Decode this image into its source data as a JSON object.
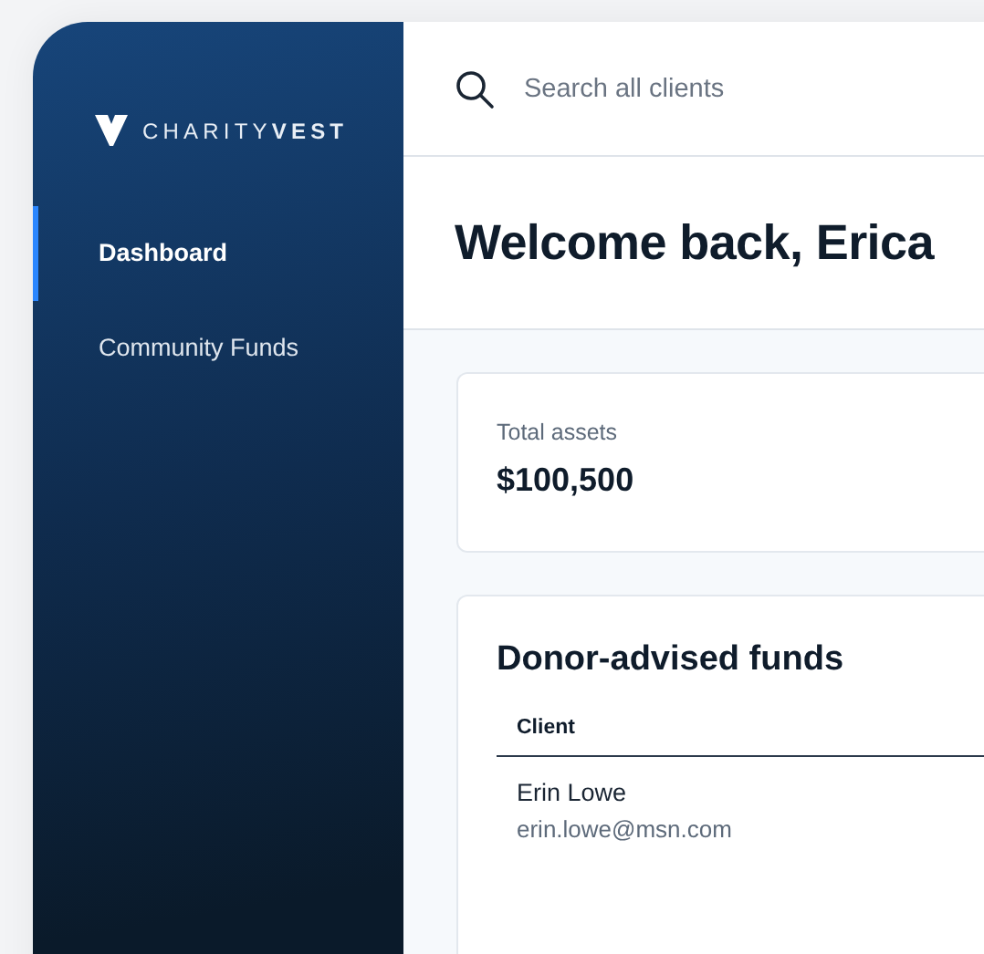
{
  "sidebar": {
    "logo": "CHARITY**VEST**",
    "items": [
      {
        "label": "Dashboard",
        "selected": true
      },
      {
        "label": "Community Funds",
        "selected": false
      }
    ]
  },
  "search": {
    "placeholder": "Search all clients"
  },
  "header": {
    "title": "Welcome back, Erica"
  },
  "summary": {
    "label": "Total assets",
    "value": "$100,500"
  },
  "funds": {
    "title": "Donor-advised funds",
    "columns": [
      "Client"
    ],
    "rows": [
      {
        "name": "Erin Lowe",
        "email": "erin.lowe@msn.com"
      }
    ]
  }
}
